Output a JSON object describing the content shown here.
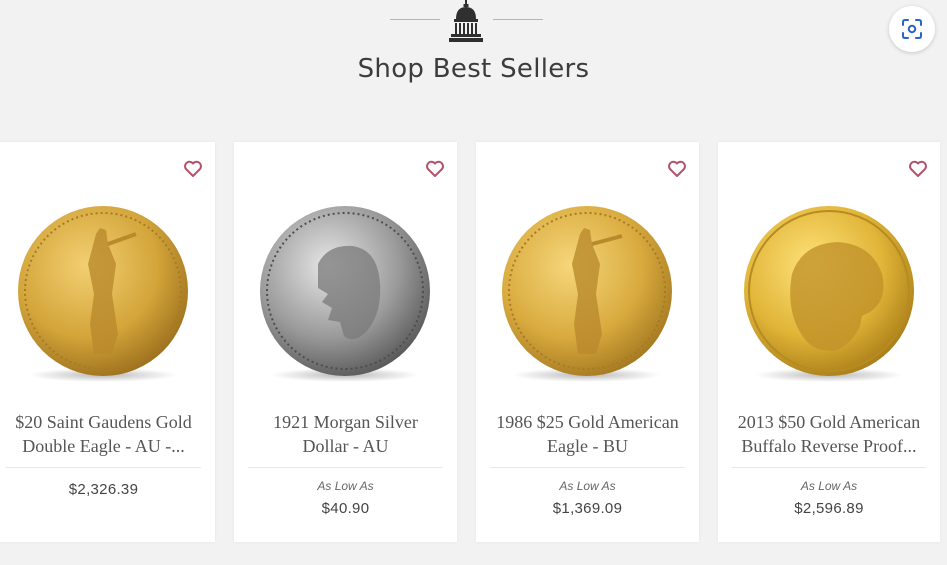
{
  "header": {
    "title": "Shop Best Sellers"
  },
  "colors": {
    "heart": "#b4516c",
    "gold": "#d3a53a",
    "silver": "#9a9a9a"
  },
  "icons": {
    "header_emblem": "capitol-dome-icon",
    "scan": "scan-lens-icon",
    "favorite": "heart-outline-icon"
  },
  "products": [
    {
      "name_line1": "$20 Saint Gaudens Gold",
      "name_line2": "Double Eagle - AU -...",
      "as_low_as": "",
      "price": "$2,326.39"
    },
    {
      "name_line1": "1921 Morgan Silver",
      "name_line2": "Dollar - AU",
      "as_low_as": "As Low As",
      "price": "$40.90"
    },
    {
      "name_line1": "1986 $25 Gold American",
      "name_line2": "Eagle - BU",
      "as_low_as": "As Low As",
      "price": "$1,369.09"
    },
    {
      "name_line1": "2013 $50 Gold American",
      "name_line2": "Buffalo Reverse Proof...",
      "as_low_as": "As Low As",
      "price": "$2,596.89"
    }
  ]
}
